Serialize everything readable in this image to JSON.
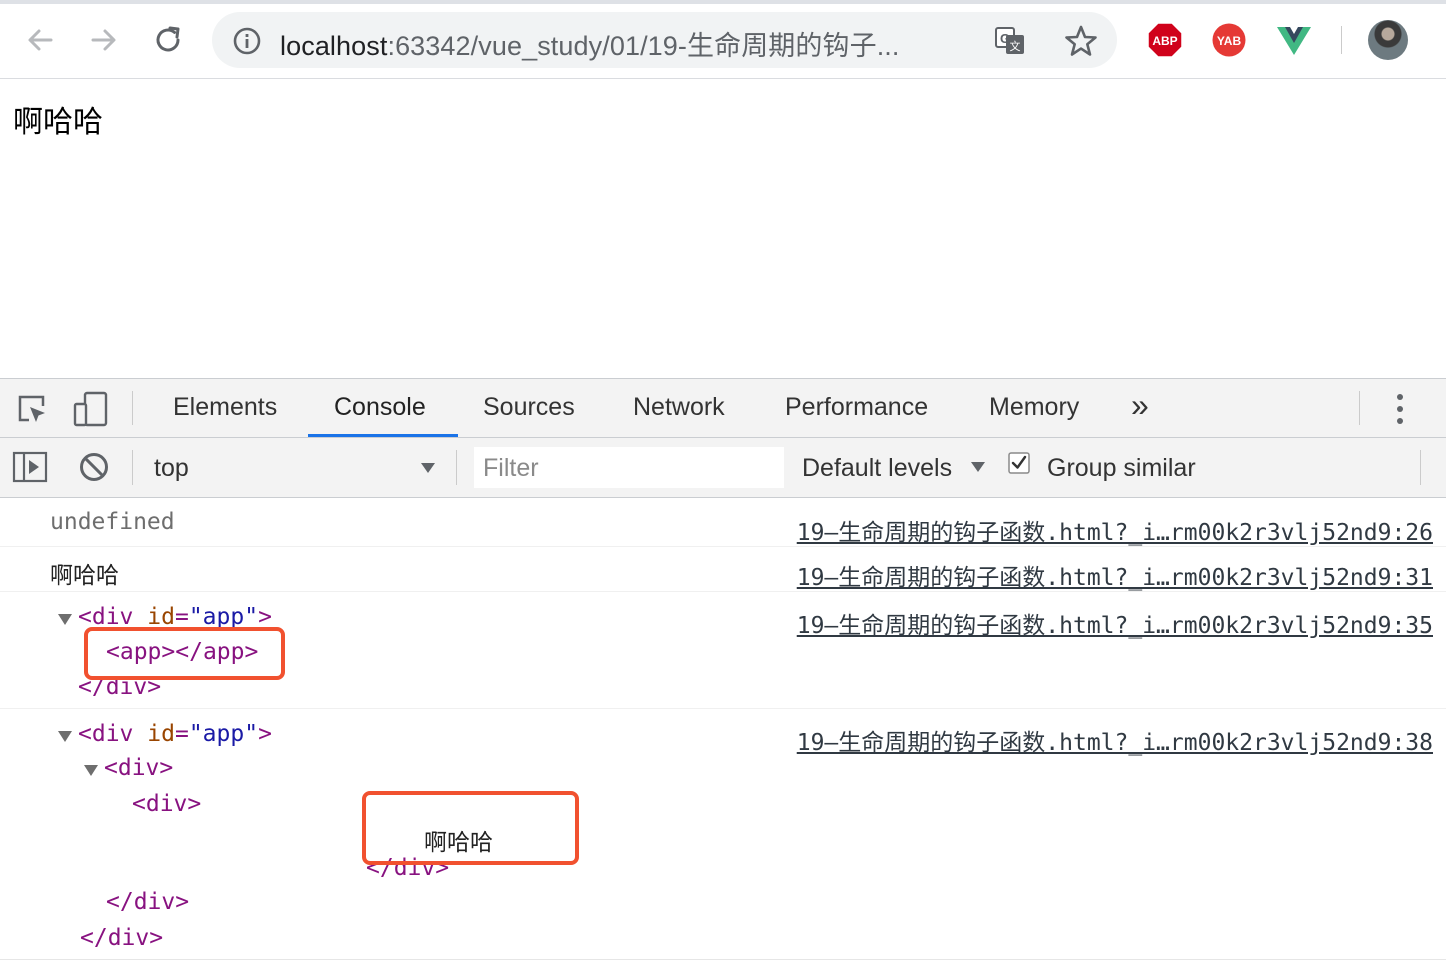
{
  "browser": {
    "url_host": "localhost",
    "url_rest": ":63342/vue_study/01/19-生命周期的钩子...",
    "extensions": [
      {
        "name": "abp-icon",
        "label": "ABP"
      },
      {
        "name": "yab-icon",
        "label": "YAB"
      },
      {
        "name": "vue-devtools-icon",
        "label": ""
      }
    ],
    "colors": {
      "abp": "#d0021b",
      "yab": "#e53935",
      "vue_green": "#41b883",
      "vue_dark": "#35495e"
    }
  },
  "page": {
    "heading": "啊哈哈"
  },
  "devtools": {
    "tabs": [
      "Elements",
      "Console",
      "Sources",
      "Network",
      "Performance",
      "Memory"
    ],
    "more_tabs": "»",
    "active_tab": "Console",
    "context": "top",
    "filter_placeholder": "Filter",
    "levels": "Default levels",
    "group_similar": "Group similar"
  },
  "console": {
    "messages": [
      {
        "text": "undefined",
        "source": "19–生命周期的钩子函数.html?_i…rm00k2r3vlj52nd9:26"
      },
      {
        "text": "啊哈哈",
        "source": "19–生命周期的钩子函数.html?_i…rm00k2r3vlj52nd9:31"
      },
      {
        "source": "19–生命周期的钩子函数.html?_i…rm00k2r3vlj52nd9:35",
        "tree": {
          "open_div": "div",
          "attr_name": "id",
          "attr_value": "\"app\"",
          "child": "app",
          "close_div": "div"
        }
      },
      {
        "source": "19–生命周期的钩子函数.html?_i…rm00k2r3vlj52nd9:38",
        "tree": {
          "open_div": "div",
          "attr_name": "id",
          "attr_value": "\"app\"",
          "inner_div": "div",
          "innermost_div": "div",
          "text": "啊哈哈",
          "close_innermost": "div",
          "close_inner": "div",
          "close_outer": "div"
        }
      }
    ]
  }
}
